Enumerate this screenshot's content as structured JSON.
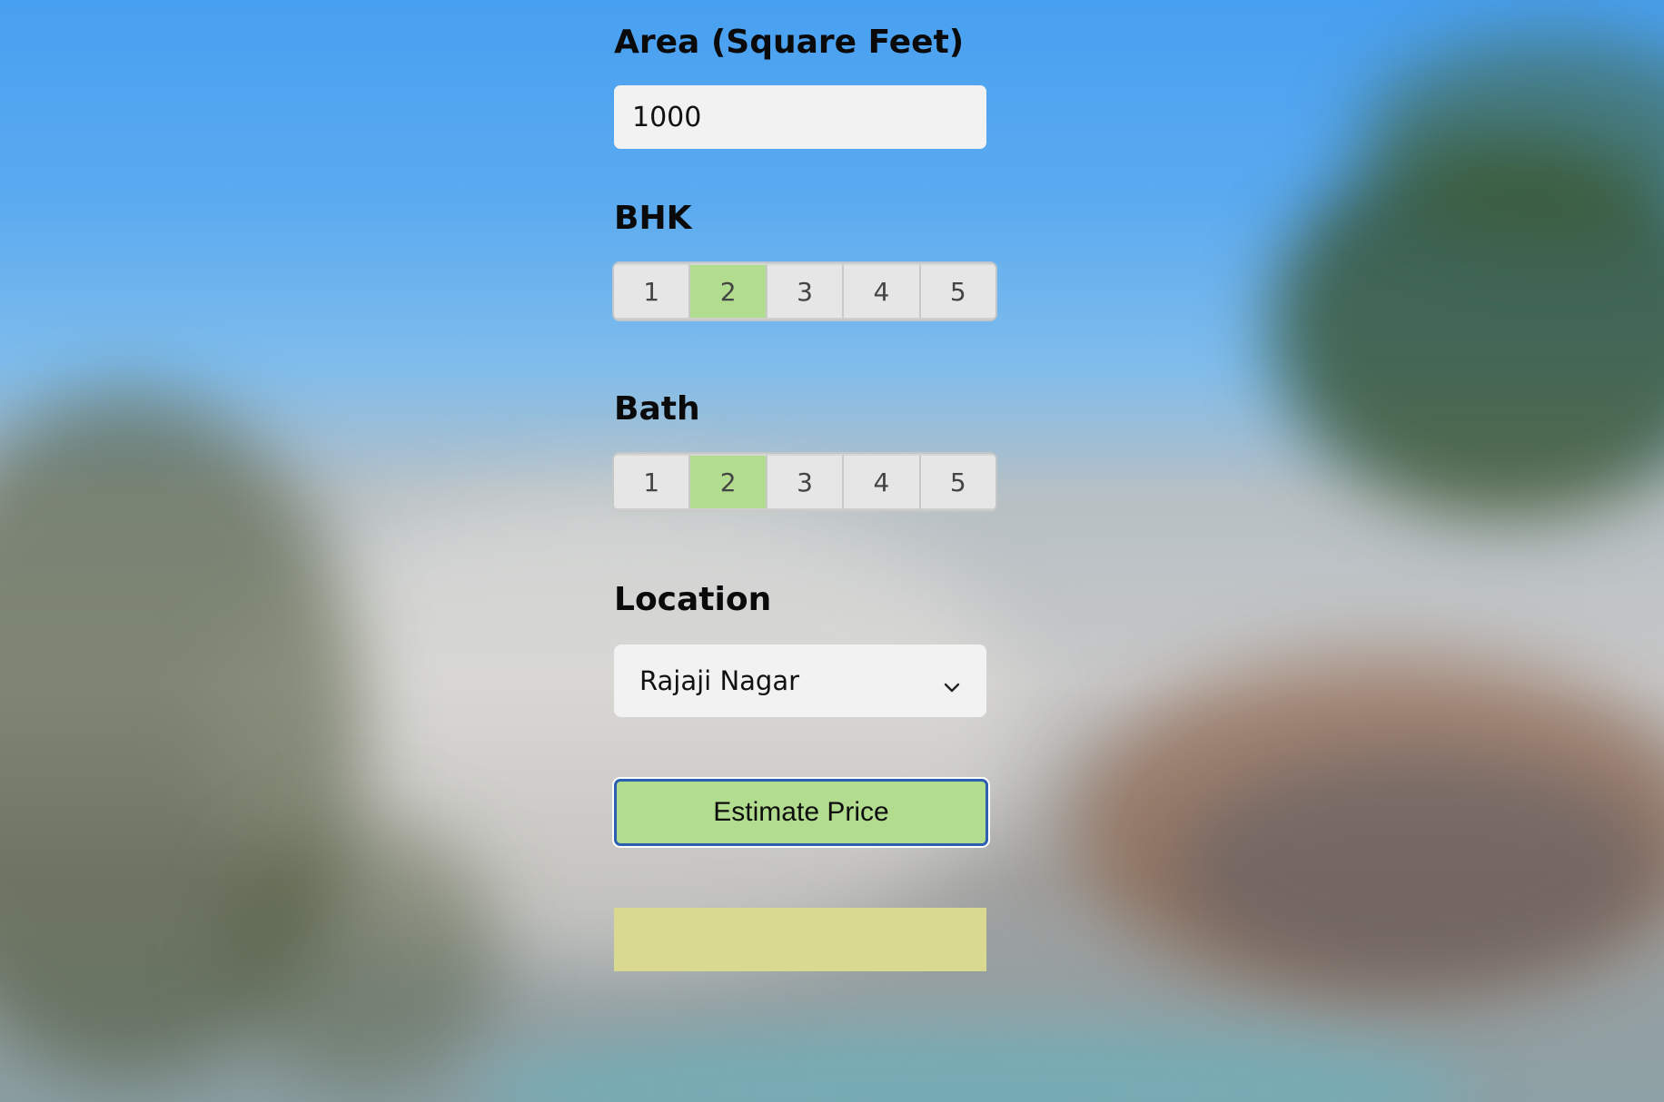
{
  "form": {
    "area_label": "Area (Square Feet)",
    "area_value": "1000",
    "bhk_label": "BHK",
    "bhk_options": [
      "1",
      "2",
      "3",
      "4",
      "5"
    ],
    "bhk_selected": "2",
    "bath_label": "Bath",
    "bath_options": [
      "1",
      "2",
      "3",
      "4",
      "5"
    ],
    "bath_selected": "2",
    "location_label": "Location",
    "location_selected": "Rajaji Nagar",
    "estimate_button_label": "Estimate Price",
    "result_text": ""
  },
  "colors": {
    "selected_option": "#b2dc8e",
    "estimate_button": "#b2dc8e",
    "estimate_border": "#2d5fb0",
    "result_box": "#d9d991",
    "input_bg": "#f2f2f2"
  },
  "icons": {
    "location_dropdown": "chevron-down-icon"
  }
}
